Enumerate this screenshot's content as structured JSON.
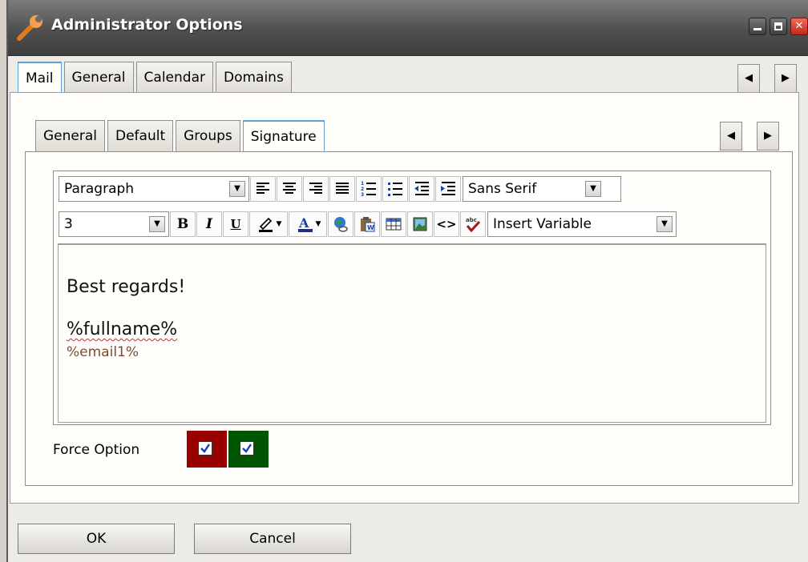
{
  "window": {
    "title": "Administrator Options"
  },
  "top_tabs": [
    {
      "label": "Mail",
      "active": true
    },
    {
      "label": "General",
      "active": false
    },
    {
      "label": "Calendar",
      "active": false
    },
    {
      "label": "Domains",
      "active": false
    }
  ],
  "sub_tabs": [
    {
      "label": "General",
      "active": false
    },
    {
      "label": "Default",
      "active": false
    },
    {
      "label": "Groups",
      "active": false
    },
    {
      "label": "Signature",
      "active": true
    }
  ],
  "toolbar": {
    "block_format": "Paragraph",
    "font_family": "Sans Serif",
    "font_size": "3",
    "bold_label": "B",
    "italic_label": "I",
    "underline_label": "U",
    "insert_variable": "Insert Variable",
    "icons": [
      "align-left-icon",
      "align-center-icon",
      "align-right-icon",
      "align-justify-icon",
      "ordered-list-icon",
      "unordered-list-icon",
      "outdent-icon",
      "indent-icon",
      "highlight-color-icon",
      "font-color-icon",
      "insert-link-icon",
      "paste-word-icon",
      "insert-table-icon",
      "insert-image-icon",
      "source-code-icon",
      "spellcheck-icon"
    ]
  },
  "signature": {
    "line1": "Best regards!",
    "line2": "%fullname%",
    "line3": "%email1%"
  },
  "force_option": {
    "label": "Force Option",
    "checkboxes": [
      {
        "checked": true,
        "color": "#990000"
      },
      {
        "checked": true,
        "color": "#005500"
      }
    ]
  },
  "buttons": {
    "ok": "OK",
    "cancel": "Cancel"
  },
  "colors": {
    "active_tab_accent": "#5fa0d6",
    "titlebar": "#4f4f4f",
    "email_variable": "#7b4a33"
  }
}
